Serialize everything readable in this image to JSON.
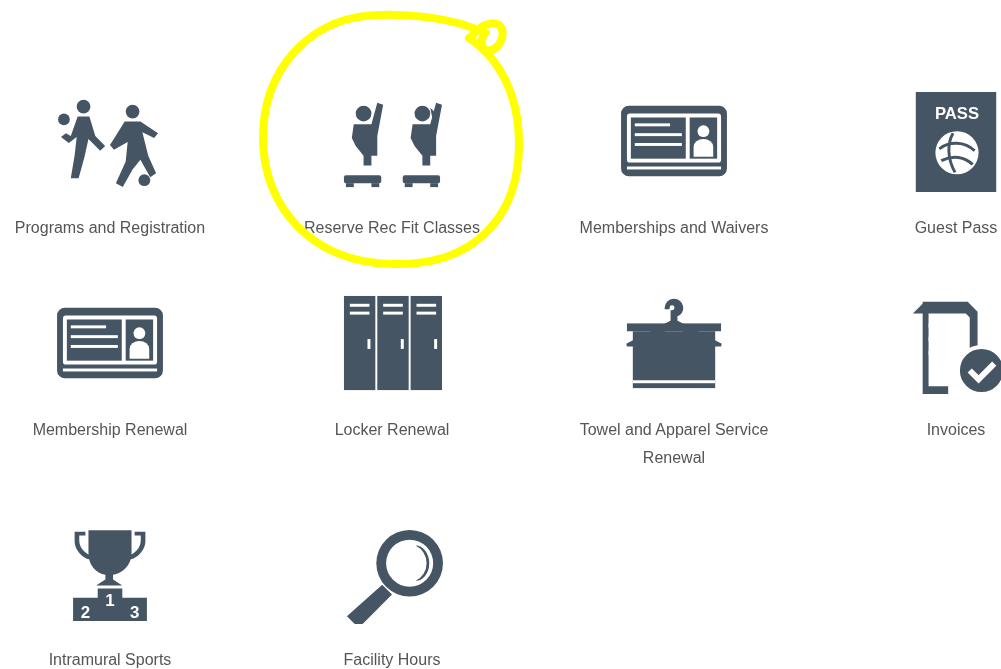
{
  "tiles": [
    {
      "kind": "players",
      "label": "Programs and Registration",
      "highlighted": false
    },
    {
      "kind": "fitness",
      "label": "Reserve Rec Fit Classes",
      "highlighted": true
    },
    {
      "kind": "id-card",
      "label": "Memberships and Waivers",
      "highlighted": false
    },
    {
      "kind": "pass",
      "label": "Guest Pass",
      "highlighted": false,
      "icon_texts": [
        "PASS"
      ]
    },
    {
      "kind": "id-card",
      "label": "Membership Renewal",
      "highlighted": false
    },
    {
      "kind": "locker",
      "label": "Locker Renewal",
      "highlighted": false
    },
    {
      "kind": "hanger",
      "label": "Towel and Apparel Service Renewal",
      "highlighted": false
    },
    {
      "kind": "invoice",
      "label": "Invoices",
      "highlighted": false
    },
    {
      "kind": "trophy",
      "label": "Intramural Sports",
      "highlighted": false,
      "icon_texts": [
        "1",
        "2",
        "3"
      ]
    },
    {
      "kind": "magnifier",
      "label": "Facility Hours",
      "highlighted": false
    }
  ]
}
